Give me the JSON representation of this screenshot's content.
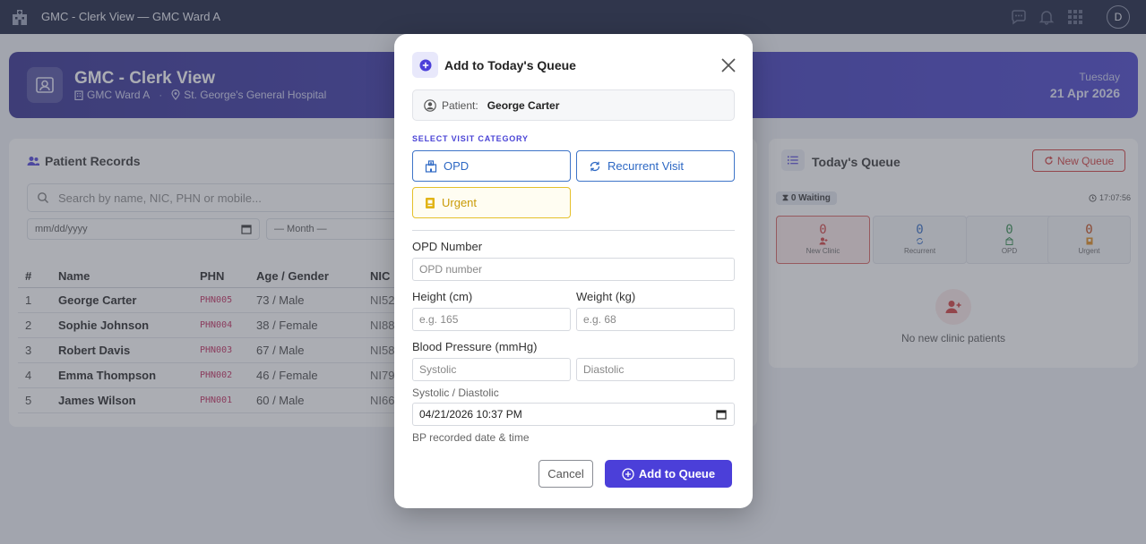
{
  "topnav": {
    "title": "GMC - Clerk View — GMC Ward A",
    "avatar": "D"
  },
  "banner": {
    "title": "GMC - Clerk View",
    "ward": "GMC Ward A",
    "hospital": "St. George's General Hospital",
    "day": "Tuesday",
    "date": "21 Apr 2026"
  },
  "records": {
    "title": "Patient Records",
    "search_placeholder": "Search by name, NIC, PHN or mobile...",
    "date_filter": "mm/dd/yyyy",
    "month_filter": "— Month —",
    "columns": [
      "#",
      "Name",
      "PHN",
      "Age / Gender",
      "NIC"
    ],
    "rows": [
      {
        "num": "1",
        "name": "George Carter",
        "phn": "PHN005",
        "age": "73 / Male",
        "nic": "NI52"
      },
      {
        "num": "2",
        "name": "Sophie Johnson",
        "phn": "PHN004",
        "age": "38 / Female",
        "nic": "NI88"
      },
      {
        "num": "3",
        "name": "Robert Davis",
        "phn": "PHN003",
        "age": "67 / Male",
        "nic": "NI58"
      },
      {
        "num": "4",
        "name": "Emma Thompson",
        "phn": "PHN002",
        "age": "46 / Female",
        "nic": "NI79"
      },
      {
        "num": "5",
        "name": "James Wilson",
        "phn": "PHN001",
        "age": "60 / Male",
        "nic": "NI66"
      }
    ]
  },
  "queue": {
    "title": "Today's Queue",
    "new_button": "New Queue",
    "waiting": "0 Waiting",
    "time": "17:07:56",
    "tiles": [
      {
        "count": "0",
        "label": "New Clinic",
        "color": "#d23a3a"
      },
      {
        "count": "0",
        "label": "Recurrent",
        "color": "#2d68c4"
      },
      {
        "count": "0",
        "label": "OPD",
        "color": "#2f8a4a"
      },
      {
        "count": "0",
        "label": "Urgent",
        "color": "#c2410c"
      }
    ],
    "empty_text": "No new clinic patients"
  },
  "modal": {
    "title": "Add to Today's Queue",
    "patient_label": "Patient:",
    "patient_name": "George Carter",
    "section_label": "SELECT VISIT CATEGORY",
    "categories": {
      "opd": "OPD",
      "recurrent": "Recurrent Visit",
      "urgent": "Urgent"
    },
    "opd_label": "OPD Number",
    "opd_placeholder": "OPD number",
    "height_label": "Height (cm)",
    "height_placeholder": "e.g. 165",
    "weight_label": "Weight (kg)",
    "weight_placeholder": "e.g. 68",
    "bp_label": "Blood Pressure (mmHg)",
    "systolic_placeholder": "Systolic",
    "diastolic_placeholder": "Diastolic",
    "bp_help": "Systolic / Diastolic",
    "datetime_value": "04/21/2026 10:37  PM",
    "datetime_help": "BP recorded date & time",
    "cancel": "Cancel",
    "submit": "Add to Queue"
  },
  "colors": {
    "accent": "#4b3fd9",
    "nav": "#141c3a",
    "danger": "#d23a3a",
    "link": "#2d68c4",
    "warning": "#e5c02a"
  }
}
